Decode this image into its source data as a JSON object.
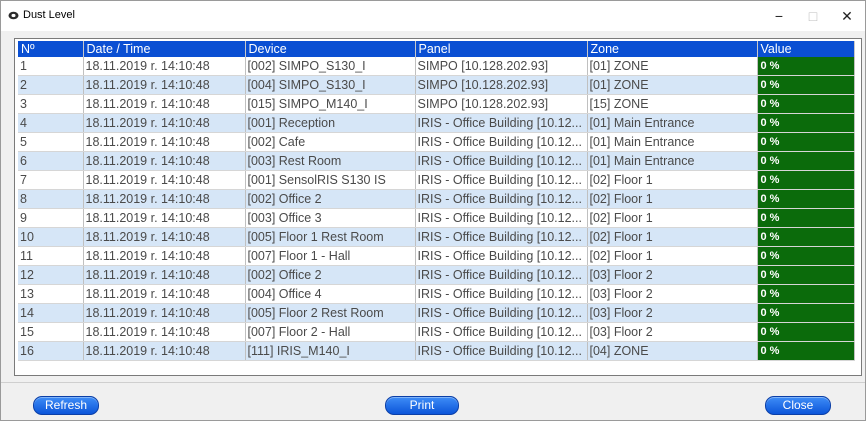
{
  "window": {
    "title": "Dust Level",
    "minimize_glyph": "−",
    "maximize_glyph": "□",
    "close_glyph": "✕"
  },
  "table": {
    "columns": [
      "Nº",
      "Date / Time",
      "Device",
      "Panel",
      "Zone",
      "Value"
    ],
    "rows": [
      {
        "no": "1",
        "datetime": "18.11.2019 r. 14:10:48",
        "device": "[002] SIMPO_S130_I",
        "panel": "SIMPO [10.128.202.93]",
        "zone": "[01] ZONE",
        "value": "0 %"
      },
      {
        "no": "2",
        "datetime": "18.11.2019 r. 14:10:48",
        "device": "[004] SIMPO_S130_I",
        "panel": "SIMPO [10.128.202.93]",
        "zone": "[01] ZONE",
        "value": "0 %"
      },
      {
        "no": "3",
        "datetime": "18.11.2019 r. 14:10:48",
        "device": "[015] SIMPO_M140_I",
        "panel": "SIMPO [10.128.202.93]",
        "zone": "[15] ZONE",
        "value": "0 %"
      },
      {
        "no": "4",
        "datetime": "18.11.2019 r. 14:10:48",
        "device": "[001] Reception",
        "panel": "IRIS - Office Building [10.12...",
        "zone": "[01] Main Entrance",
        "value": "0 %"
      },
      {
        "no": "5",
        "datetime": "18.11.2019 r. 14:10:48",
        "device": "[002] Cafe",
        "panel": "IRIS - Office Building [10.12...",
        "zone": "[01] Main Entrance",
        "value": "0 %"
      },
      {
        "no": "6",
        "datetime": "18.11.2019 r. 14:10:48",
        "device": "[003] Rest Room",
        "panel": "IRIS - Office Building [10.12...",
        "zone": "[01] Main Entrance",
        "value": "0 %"
      },
      {
        "no": "7",
        "datetime": "18.11.2019 r. 14:10:48",
        "device": "[001] SensolRIS S130 IS",
        "panel": "IRIS - Office Building [10.12...",
        "zone": "[02] Floor 1",
        "value": "0 %"
      },
      {
        "no": "8",
        "datetime": "18.11.2019 r. 14:10:48",
        "device": "[002] Office 2",
        "panel": "IRIS - Office Building [10.12...",
        "zone": "[02] Floor 1",
        "value": "0 %"
      },
      {
        "no": "9",
        "datetime": "18.11.2019 r. 14:10:48",
        "device": "[003] Office 3",
        "panel": "IRIS - Office Building [10.12...",
        "zone": "[02] Floor 1",
        "value": "0 %"
      },
      {
        "no": "10",
        "datetime": "18.11.2019 r. 14:10:48",
        "device": "[005] Floor 1 Rest Room",
        "panel": "IRIS - Office Building [10.12...",
        "zone": "[02] Floor 1",
        "value": "0 %"
      },
      {
        "no": "11",
        "datetime": "18.11.2019 r. 14:10:48",
        "device": "[007] Floor 1 - Hall",
        "panel": "IRIS - Office Building [10.12...",
        "zone": "[02] Floor 1",
        "value": "0 %"
      },
      {
        "no": "12",
        "datetime": "18.11.2019 r. 14:10:48",
        "device": "[002] Office 2",
        "panel": "IRIS - Office Building [10.12...",
        "zone": "[03] Floor 2",
        "value": "0 %"
      },
      {
        "no": "13",
        "datetime": "18.11.2019 r. 14:10:48",
        "device": "[004] Office 4",
        "panel": "IRIS - Office Building [10.12...",
        "zone": "[03] Floor 2",
        "value": "0 %"
      },
      {
        "no": "14",
        "datetime": "18.11.2019 r. 14:10:48",
        "device": "[005] Floor 2 Rest Room",
        "panel": "IRIS - Office Building [10.12...",
        "zone": "[03] Floor 2",
        "value": "0 %"
      },
      {
        "no": "15",
        "datetime": "18.11.2019 r. 14:10:48",
        "device": "[007] Floor 2 - Hall",
        "panel": "IRIS - Office Building [10.12...",
        "zone": "[03] Floor 2",
        "value": "0 %"
      },
      {
        "no": "16",
        "datetime": "18.11.2019 r. 14:10:48",
        "device": "[111] IRIS_M140_I",
        "panel": "IRIS - Office Building [10.12...",
        "zone": "[04] ZONE",
        "value": "0 %"
      }
    ]
  },
  "buttons": {
    "refresh": "Refresh",
    "print": "Print",
    "close": "Close"
  },
  "colors": {
    "header_bg": "#0a4fd3",
    "alt_row_bg": "#d6e6f7",
    "value_bg": "#0b6b0b",
    "button_bg": "#1565e8"
  },
  "icons": {
    "app": "app-icon",
    "minimize": "minimize-icon",
    "maximize": "maximize-icon",
    "close": "close-icon"
  }
}
